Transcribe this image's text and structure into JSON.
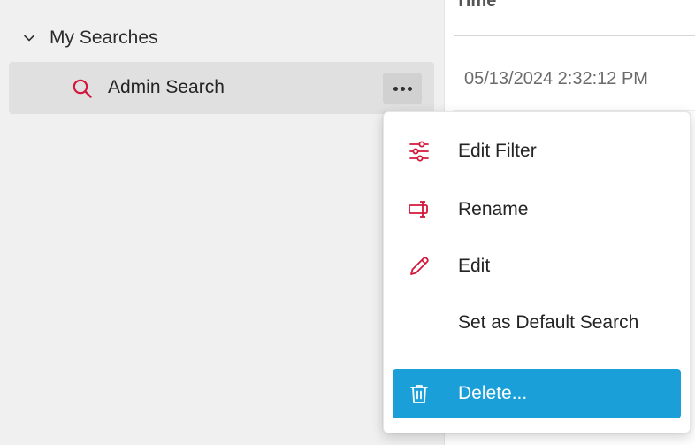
{
  "tree": {
    "group_label": "My Searches",
    "item_label": "Admin Search"
  },
  "grid": {
    "header_label": "Time",
    "rows": [
      "05/13/2024 2:32:12 PM"
    ]
  },
  "menu": {
    "items": [
      {
        "label": "Edit Filter",
        "icon": "filter-sliders-icon"
      },
      {
        "label": "Rename",
        "icon": "rename-icon"
      },
      {
        "label": "Edit",
        "icon": "pencil-icon"
      },
      {
        "label": "Set as Default Search",
        "icon": ""
      },
      {
        "label": "Delete...",
        "icon": "trash-icon"
      }
    ]
  },
  "colors": {
    "accent_red": "#d3173b",
    "selected_blue": "#1b9fd8"
  }
}
